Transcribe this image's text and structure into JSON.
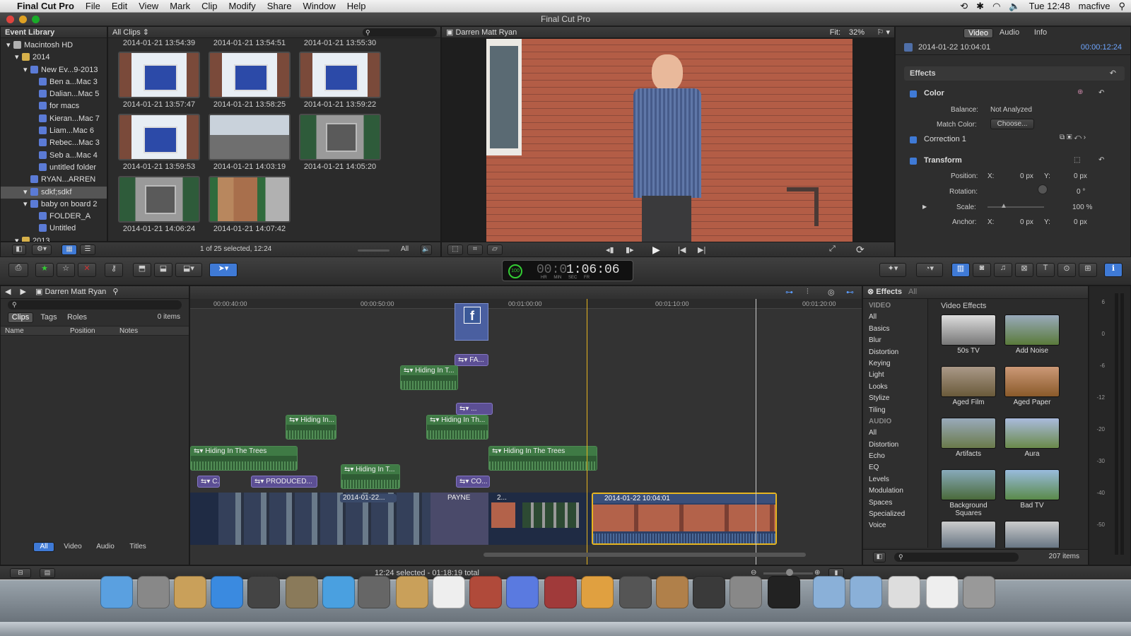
{
  "menubar": {
    "apple": "",
    "app": "Final Cut Pro",
    "items": [
      "File",
      "Edit",
      "View",
      "Mark",
      "Clip",
      "Modify",
      "Share",
      "Window",
      "Help"
    ],
    "clock": "Tue 12:48",
    "user": "macfive"
  },
  "window": {
    "title": "Final Cut Pro"
  },
  "library": {
    "header": "Event Library",
    "filter": "All Clips",
    "items": [
      {
        "label": "Macintosh HD",
        "level": 0,
        "icon": "disk"
      },
      {
        "label": "2014",
        "level": 1,
        "icon": "folder"
      },
      {
        "label": "New Ev...9-2013",
        "level": 2,
        "icon": "event"
      },
      {
        "label": "Ben a...Mac 3",
        "level": 3,
        "icon": "event"
      },
      {
        "label": "Dalian...Mac 5",
        "level": 3,
        "icon": "event"
      },
      {
        "label": "for macs",
        "level": 3,
        "icon": "event"
      },
      {
        "label": "Kieran...Mac 7",
        "level": 3,
        "icon": "event"
      },
      {
        "label": "Liam...Mac 6",
        "level": 3,
        "icon": "event"
      },
      {
        "label": "Rebec...Mac 3",
        "level": 3,
        "icon": "event"
      },
      {
        "label": "Seb a...Mac 4",
        "level": 3,
        "icon": "event"
      },
      {
        "label": "untitled folder",
        "level": 3,
        "icon": "event"
      },
      {
        "label": "RYAN...ARREN",
        "level": 2,
        "icon": "event"
      },
      {
        "label": "sdkf;sdkf",
        "level": 2,
        "icon": "event",
        "selected": true
      },
      {
        "label": "baby on board 2",
        "level": 2,
        "icon": "event"
      },
      {
        "label": "FOLDER_A",
        "level": 3,
        "icon": "event"
      },
      {
        "label": "Untitled",
        "level": 3,
        "icon": "event"
      },
      {
        "label": "2013",
        "level": 1,
        "icon": "folder"
      }
    ],
    "timestamps_top": [
      "2014-01-21 13:54:39",
      "2014-01-21 13:54:51",
      "2014-01-21 13:55:30"
    ],
    "clips": [
      {
        "ts": "2014-01-21 13:57:47",
        "kind": "door"
      },
      {
        "ts": "2014-01-21 13:58:25",
        "kind": "door"
      },
      {
        "ts": "2014-01-21 13:59:22",
        "kind": "door"
      },
      {
        "ts": "2014-01-21 13:59:53",
        "kind": "door"
      },
      {
        "ts": "2014-01-21 14:03:19",
        "kind": "street"
      },
      {
        "ts": "2014-01-21 14:05:20",
        "kind": "keypad"
      },
      {
        "ts": "2014-01-21 14:06:24",
        "kind": "keypad"
      },
      {
        "ts": "2014-01-21 14:07:42",
        "kind": "fence"
      }
    ],
    "status": "1 of 25 selected, 12:24",
    "duration_label": "All"
  },
  "viewer": {
    "title": "Darren Matt Ryan",
    "fit_label": "Fit:",
    "fit_value": "32%"
  },
  "inspector": {
    "tabs": [
      "Video",
      "Audio",
      "Info"
    ],
    "clip_name": "2014-01-22 10:04:01",
    "duration": "00:00:12:24",
    "effects_label": "Effects",
    "color_label": "Color",
    "balance_label": "Balance:",
    "balance_value": "Not Analyzed",
    "match_label": "Match Color:",
    "match_button": "Choose...",
    "correction_label": "Correction 1",
    "transform_label": "Transform",
    "position_label": "Position:",
    "x_label": "X:",
    "y_label": "Y:",
    "pos_x": "0 px",
    "pos_y": "0 px",
    "rotation_label": "Rotation:",
    "rotation_value": "0 °",
    "scale_label": "Scale:",
    "scale_value": "100 %",
    "anchor_label": "Anchor:",
    "anchor_x": "0 px",
    "anchor_y": "0 px"
  },
  "toolbar": {
    "timecode": "1:06:06",
    "timecode_prefix": "00:0",
    "tc_units": [
      "HR",
      "MIN",
      "SEC",
      "FR"
    ],
    "percent": "100"
  },
  "timeline": {
    "project": "Darren Matt Ryan",
    "ruler": [
      "00:00:40:00",
      "00:00:50:00",
      "00:01:00:00",
      "00:01:10:00",
      "00:01:20:00"
    ],
    "audio_clips": [
      {
        "label": "Hiding In The Trees"
      },
      {
        "label": "Hiding In..."
      },
      {
        "label": "Hiding In T..."
      },
      {
        "label": "Hiding In Th..."
      },
      {
        "label": "Hiding In T..."
      },
      {
        "label": "Hiding In The Trees"
      }
    ],
    "title_clips": [
      {
        "label": "C."
      },
      {
        "label": "PRODUCED..."
      },
      {
        "label": "CO..."
      },
      {
        "label": "FA..."
      },
      {
        "label": "..."
      }
    ],
    "primary": [
      {
        "label": "2014-01-22..."
      },
      {
        "label": "PAYNE"
      },
      {
        "label": "2..."
      },
      {
        "label": "2014-01-22 10:04:01"
      }
    ]
  },
  "timeline_index": {
    "tabs": [
      "Clips",
      "Tags",
      "Roles"
    ],
    "count": "0 items",
    "columns": [
      "Name",
      "Position",
      "Notes"
    ],
    "bottom_tabs": [
      "All",
      "Video",
      "Audio",
      "Titles"
    ]
  },
  "effects": {
    "header": "Effects",
    "header_filter": "All",
    "video_section": "VIDEO",
    "video_cats": [
      "All",
      "Basics",
      "Blur",
      "Distortion",
      "Keying",
      "Light",
      "Looks",
      "Stylize",
      "Tiling"
    ],
    "audio_section": "AUDIO",
    "audio_cats": [
      "All",
      "Distortion",
      "Echo",
      "EQ",
      "Levels",
      "Modulation",
      "Spaces",
      "Specialized",
      "Voice"
    ],
    "browser_title": "Video Effects",
    "items": [
      "50s TV",
      "Add Noise",
      "Aged Film",
      "Aged Paper",
      "Artifacts",
      "Aura",
      "Background Squares",
      "Bad TV"
    ],
    "count": "207 items"
  },
  "meters": {
    "labels": [
      "6",
      "0",
      "-6",
      "-12",
      "-20",
      "-30",
      "-40",
      "-50"
    ]
  },
  "statusbar": {
    "text": "12:24 selected - 01:18:19 total"
  },
  "colors": {
    "accent": "#3f7ad6",
    "audio": "#2f5c34",
    "title": "#5c4f94",
    "selection": "#e6b520"
  }
}
